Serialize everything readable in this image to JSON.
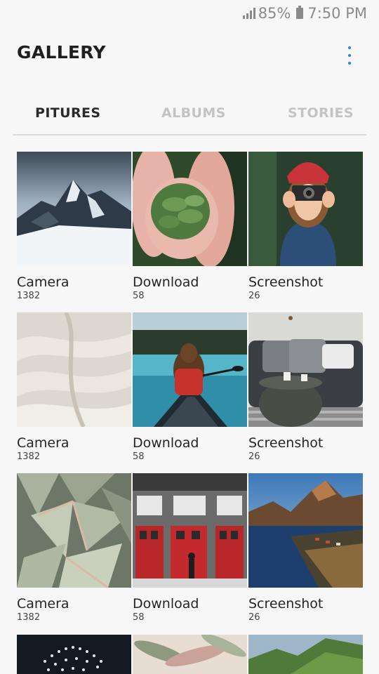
{
  "status_bar": {
    "battery": "85%",
    "time": "7:50 PM",
    "icons": [
      "signal-icon",
      "battery-icon"
    ]
  },
  "header": {
    "title": "GALLERY",
    "menu_icon": "more-vert-icon"
  },
  "tabs": [
    {
      "label": "PITURES",
      "active": true
    },
    {
      "label": "ALBUMS",
      "active": false
    },
    {
      "label": "STORIES",
      "active": false
    }
  ],
  "albums": [
    {
      "name": "Camera",
      "count": "1382",
      "image": "snowy-mountain"
    },
    {
      "name": "Download",
      "count": "58",
      "image": "hands-holding-plant"
    },
    {
      "name": "Screenshot",
      "count": "26",
      "image": "woman-with-camera"
    },
    {
      "name": "Camera",
      "count": "1382",
      "image": "white-fabric"
    },
    {
      "name": "Download",
      "count": "58",
      "image": "woman-in-canoe"
    },
    {
      "name": "Screenshot",
      "count": "26",
      "image": "grey-sofa-living-room"
    },
    {
      "name": "Camera",
      "count": "1382",
      "image": "succulent-leaves"
    },
    {
      "name": "Download",
      "count": "58",
      "image": "red-fire-station-doors"
    },
    {
      "name": "Screenshot",
      "count": "26",
      "image": "coastal-mountain-village"
    },
    {
      "name": "",
      "count": "",
      "image": "night-lights"
    },
    {
      "name": "",
      "count": "",
      "image": "dried-leaves"
    },
    {
      "name": "",
      "count": "",
      "image": "green-hills"
    }
  ],
  "colors": {
    "background": "#f7f7f7",
    "accent": "#2b86d8",
    "tab_inactive": "#c3c3c3"
  }
}
